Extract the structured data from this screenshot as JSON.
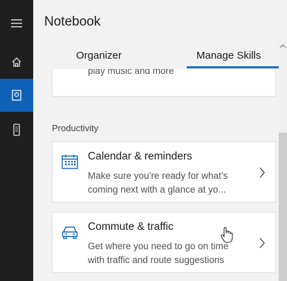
{
  "app": {
    "title": "Notebook"
  },
  "rail": {
    "items": [
      {
        "name": "menu-icon"
      },
      {
        "name": "home-icon"
      },
      {
        "name": "notebook-icon",
        "active": true
      },
      {
        "name": "device-icon"
      }
    ]
  },
  "tabs": {
    "items": [
      {
        "label": "Organizer"
      },
      {
        "label": "Manage Skills",
        "selected": true
      }
    ]
  },
  "cards": {
    "top": {
      "description": "Link your favorite music provider to play music and more"
    },
    "section": "Productivity",
    "calendar": {
      "title": "Calendar & reminders",
      "description": "Make sure you’re ready for what’s coming next with a glance at yo...",
      "icon": "calendar-icon"
    },
    "commute": {
      "title": "Commute & traffic",
      "description": "Get where you need to go on time with traffic and route suggestions",
      "icon": "car-icon"
    }
  },
  "colors": {
    "rail": "#1f1f1f",
    "accent": "#0f62b8",
    "tab_underline": "#0f6cc6",
    "background": "#f2f2f2"
  }
}
